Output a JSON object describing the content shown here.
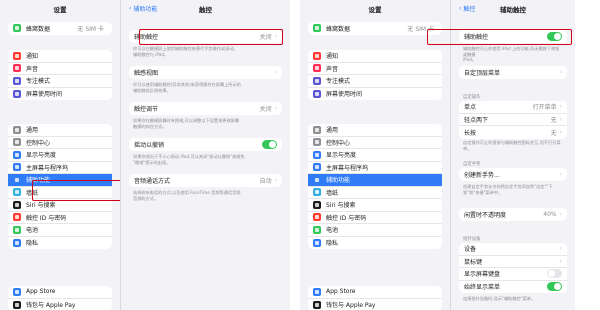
{
  "left": {
    "title": "设置",
    "top_row": {
      "label": "蜂窝数据",
      "value": "无 SIM 卡",
      "color": "#34c759"
    },
    "group1": [
      {
        "label": "通知",
        "icon": "bell-icon",
        "color": "#ff3b30"
      },
      {
        "label": "声音",
        "icon": "speaker-icon",
        "color": "#ff2d55"
      },
      {
        "label": "专注模式",
        "icon": "moon-icon",
        "color": "#5856d6"
      },
      {
        "label": "屏幕使用时间",
        "icon": "hourglass-icon",
        "color": "#5856d6"
      }
    ],
    "group2": [
      {
        "label": "通用",
        "icon": "gear-icon",
        "color": "#8e8e93"
      },
      {
        "label": "控制中心",
        "icon": "toggles-icon",
        "color": "#8e8e93"
      },
      {
        "label": "显示与亮度",
        "icon": "sun-icon",
        "color": "#2f7cf6"
      },
      {
        "label": "主屏幕与程序坞",
        "icon": "grid-icon",
        "color": "#2f7cf6"
      },
      {
        "label": "辅助功能",
        "icon": "accessibility-icon",
        "color": "#2f7cf6",
        "selected": true
      },
      {
        "label": "墙纸",
        "icon": "flower-icon",
        "color": "#32ade6"
      },
      {
        "label": "Siri 与搜索",
        "icon": "siri-icon",
        "color": "#1c1c1e"
      },
      {
        "label": "触控 ID 与密码",
        "icon": "fingerprint-icon",
        "color": "#ff3b30"
      },
      {
        "label": "电池",
        "icon": "battery-icon",
        "color": "#34c759"
      },
      {
        "label": "隐私",
        "icon": "hand-icon",
        "color": "#2f7cf6"
      }
    ],
    "group3": [
      {
        "label": "App Store",
        "icon": "appstore-icon",
        "color": "#2f7cf6"
      },
      {
        "label": "钱包与 Apple Pay",
        "icon": "wallet-icon",
        "color": "#1c1c1e"
      }
    ]
  },
  "mid": {
    "back": "辅助功能",
    "title": "触控",
    "assistive": {
      "label": "辅助触控",
      "value": "关闭"
    },
    "note1": "你可以在触摸屏上使用辅助触控来替代手势操作或滚动。\n辅助触控与 iPad。",
    "haptic": {
      "label": "触感视图"
    },
    "note2": "你可以使用辅助触控(而非其他)来获得操作在屏幕上所示的\n辅助触觉反馈效果。",
    "touch_adj": {
      "label": "触控调节",
      "value": "关闭"
    },
    "note3": "如果你在触摸屏幕时有困难,可以调整以下设置来更改屏幕\n触摸的响应方式。",
    "shake": {
      "label": "摇动以撤销"
    },
    "note4": "如果你倾向于不小心摇动 iPad,可以关闭\"摇动以撤销\"来避免\n\"撤销\"提示的出现。",
    "audio": {
      "label": "音频通话方式",
      "value": "自动"
    },
    "note5": "选择收听电话的方式,以及使用 FaceTime 音频等通话音频\n音频的方式。"
  },
  "right": {
    "title": "设置",
    "top_row": {
      "label": "蜂窝数据",
      "value": "无 SIM 卡",
      "color": "#34c759"
    },
    "group1": [
      {
        "label": "通知",
        "icon": "bell-icon",
        "color": "#ff3b30"
      },
      {
        "label": "声音",
        "icon": "speaker-icon",
        "color": "#ff2d55"
      },
      {
        "label": "专注模式",
        "icon": "moon-icon",
        "color": "#5856d6"
      },
      {
        "label": "屏幕使用时间",
        "icon": "hourglass-icon",
        "color": "#5856d6"
      }
    ],
    "group2": [
      {
        "label": "通用",
        "icon": "gear-icon",
        "color": "#8e8e93"
      },
      {
        "label": "控制中心",
        "icon": "toggles-icon",
        "color": "#8e8e93"
      },
      {
        "label": "显示与亮度",
        "icon": "sun-icon",
        "color": "#2f7cf6"
      },
      {
        "label": "主屏幕与程序坞",
        "icon": "grid-icon",
        "color": "#2f7cf6"
      },
      {
        "label": "辅助功能",
        "icon": "accessibility-icon",
        "color": "#2f7cf6",
        "selected": true
      },
      {
        "label": "墙纸",
        "icon": "flower-icon",
        "color": "#32ade6"
      },
      {
        "label": "Siri 与搜索",
        "icon": "siri-icon",
        "color": "#1c1c1e"
      },
      {
        "label": "触控 ID 与密码",
        "icon": "fingerprint-icon",
        "color": "#ff3b30"
      },
      {
        "label": "电池",
        "icon": "battery-icon",
        "color": "#34c759"
      },
      {
        "label": "隐私",
        "icon": "hand-icon",
        "color": "#2f7cf6"
      }
    ],
    "group3": [
      {
        "label": "App Store",
        "icon": "appstore-icon",
        "color": "#2f7cf6"
      },
      {
        "label": "钱包与 Apple Pay",
        "icon": "wallet-icon",
        "color": "#1c1c1e"
      }
    ]
  },
  "detail": {
    "back": "触控",
    "title": "辅助触控",
    "assistive": {
      "label": "辅助触控"
    },
    "note1": "辅助触控可让你使用 iPad 上的功能,而无需按下按钮或触摸\niPad。",
    "custom_menu": {
      "label": "自定顶层菜单"
    },
    "section_custom": "自定操作",
    "single": {
      "label": "单点",
      "value": "打开菜单"
    },
    "double": {
      "label": "轻点两下",
      "value": "无"
    },
    "long": {
      "label": "长按",
      "value": "无"
    },
    "note2": "自定操作可让你直接与辅助触控图标交互,而不打开菜单。",
    "section_gesture": "自定手势",
    "create_gesture": {
      "label": "创建新手势..."
    },
    "note3": "创建自定手势允许你将自定手势添加到\"自定\"\"下划\"和\"快捷\"菜单中。",
    "idle_opacity": {
      "label": "闲置时不透明度",
      "value": "40%"
    },
    "section_pointer": "指针设备",
    "devices": {
      "label": "设备"
    },
    "mouse_keys": {
      "label": "鼠标键"
    },
    "onscreen_kb": {
      "label": "显示屏幕键盘"
    },
    "always_menu": {
      "label": "始终显示菜单"
    },
    "note4": "连接指针设备时,显示\"辅助触控\"菜单。"
  }
}
